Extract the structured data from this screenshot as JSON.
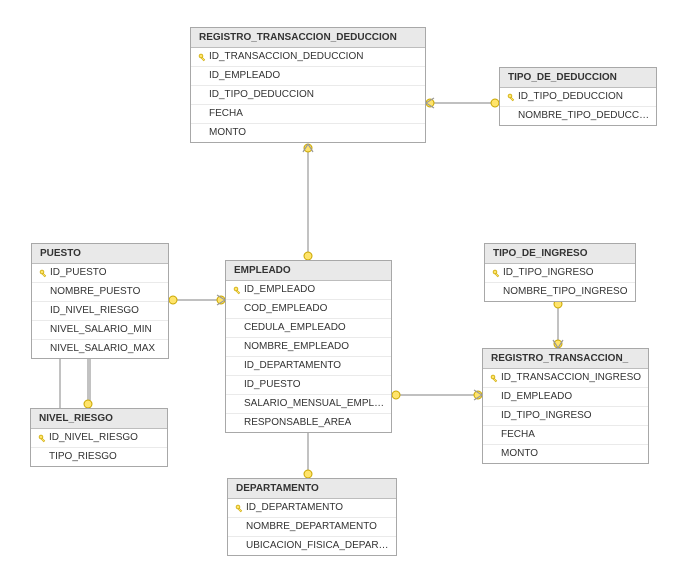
{
  "tables": {
    "registro_transaccion_deduccion": {
      "title": "REGISTRO_TRANSACCION_DEDUCCION",
      "cols": [
        {
          "pk": true,
          "name": "ID_TRANSACCION_DEDUCCION"
        },
        {
          "pk": false,
          "name": "ID_EMPLEADO"
        },
        {
          "pk": false,
          "name": "ID_TIPO_DEDUCCION"
        },
        {
          "pk": false,
          "name": "FECHA"
        },
        {
          "pk": false,
          "name": "MONTO"
        }
      ]
    },
    "tipo_de_deduccion": {
      "title": "TIPO_DE_DEDUCCION",
      "cols": [
        {
          "pk": true,
          "name": "ID_TIPO_DEDUCCION"
        },
        {
          "pk": false,
          "name": "NOMBRE_TIPO_DEDUCCION"
        }
      ]
    },
    "puesto": {
      "title": "PUESTO",
      "cols": [
        {
          "pk": true,
          "name": "ID_PUESTO"
        },
        {
          "pk": false,
          "name": "NOMBRE_PUESTO"
        },
        {
          "pk": false,
          "name": "ID_NIVEL_RIESGO"
        },
        {
          "pk": false,
          "name": "NIVEL_SALARIO_MIN"
        },
        {
          "pk": false,
          "name": "NIVEL_SALARIO_MAX"
        }
      ]
    },
    "empleado": {
      "title": "EMPLEADO",
      "cols": [
        {
          "pk": true,
          "name": "ID_EMPLEADO"
        },
        {
          "pk": false,
          "name": "COD_EMPLEADO"
        },
        {
          "pk": false,
          "name": "CEDULA_EMPLEADO"
        },
        {
          "pk": false,
          "name": "NOMBRE_EMPLEADO"
        },
        {
          "pk": false,
          "name": "ID_DEPARTAMENTO"
        },
        {
          "pk": false,
          "name": "ID_PUESTO"
        },
        {
          "pk": false,
          "name": "SALARIO_MENSUAL_EMPLEA..."
        },
        {
          "pk": false,
          "name": "RESPONSABLE_AREA"
        }
      ]
    },
    "tipo_de_ingreso": {
      "title": "TIPO_DE_INGRESO",
      "cols": [
        {
          "pk": true,
          "name": "ID_TIPO_INGRESO"
        },
        {
          "pk": false,
          "name": "NOMBRE_TIPO_INGRESO"
        }
      ]
    },
    "registro_transaccion_ingreso": {
      "title": "REGISTRO_TRANSACCION_",
      "cols": [
        {
          "pk": true,
          "name": "ID_TRANSACCION_INGRESO"
        },
        {
          "pk": false,
          "name": "ID_EMPLEADO"
        },
        {
          "pk": false,
          "name": "ID_TIPO_INGRESO"
        },
        {
          "pk": false,
          "name": "FECHA"
        },
        {
          "pk": false,
          "name": "MONTO"
        }
      ]
    },
    "nivel_riesgo": {
      "title": "NIVEL_RIESGO",
      "cols": [
        {
          "pk": true,
          "name": "ID_NIVEL_RIESGO"
        },
        {
          "pk": false,
          "name": "TIPO_RIESGO"
        }
      ]
    },
    "departamento": {
      "title": "DEPARTAMENTO",
      "cols": [
        {
          "pk": true,
          "name": "ID_DEPARTAMENTO"
        },
        {
          "pk": false,
          "name": "NOMBRE_DEPARTAMENTO"
        },
        {
          "pk": false,
          "name": "UBICACION_FISICA_DEPARTA..."
        }
      ]
    }
  }
}
